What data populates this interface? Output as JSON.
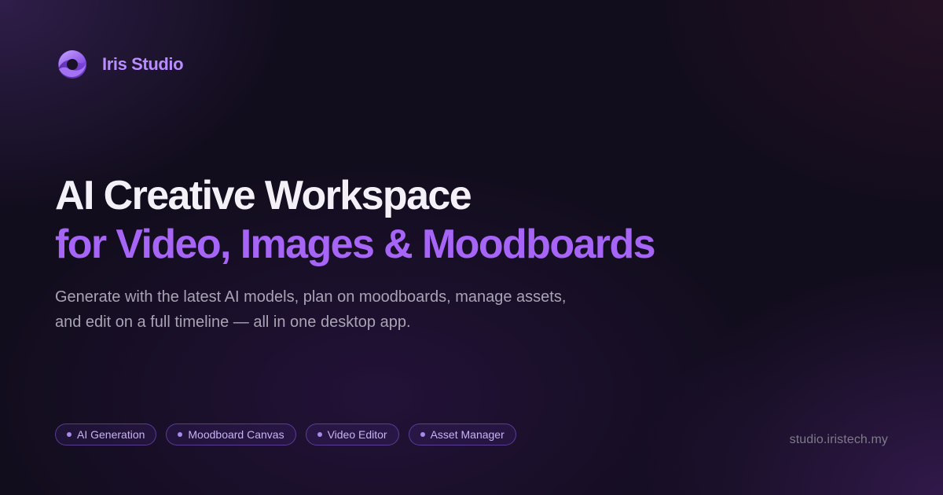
{
  "brand": {
    "name": "Iris Studio",
    "logo_icon": "iris-swirl-logo-icon"
  },
  "hero": {
    "title_line_1": "AI Creative Workspace",
    "title_line_2": "for Video, Images & Moodboards",
    "subtitle_line_1": "Generate with the latest AI models, plan on moodboards, manage assets,",
    "subtitle_line_2": "and edit on a full timeline — all in one desktop app."
  },
  "features": [
    {
      "label": "AI Generation"
    },
    {
      "label": "Moodboard Canvas"
    },
    {
      "label": "Video Editor"
    },
    {
      "label": "Asset Manager"
    }
  ],
  "footer": {
    "url": "studio.iristech.my"
  },
  "colors": {
    "background": "#120d1d",
    "accent_purple": "#a765f8",
    "brand_text": "#b98cff",
    "title_white": "#f3f1f7",
    "subtitle_gray": "#a9a4b4",
    "chip_text": "#c9b2f3",
    "url_gray": "#7e7a8a"
  }
}
